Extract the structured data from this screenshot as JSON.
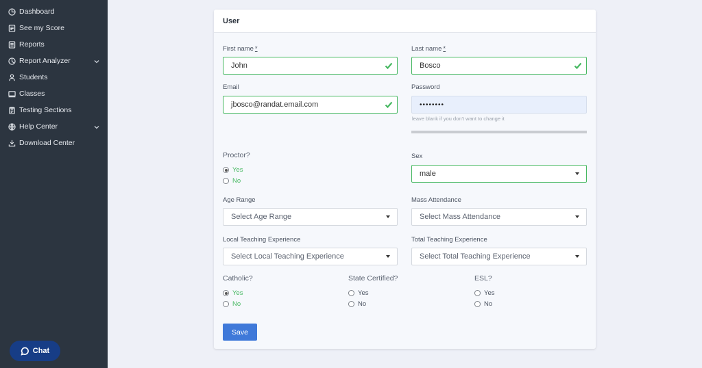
{
  "sidebar": {
    "items": [
      {
        "label": "Dashboard",
        "icon": "dashboard-icon"
      },
      {
        "label": "See my Score",
        "icon": "score-icon"
      },
      {
        "label": "Reports",
        "icon": "reports-icon"
      },
      {
        "label": "Report Analyzer",
        "icon": "analyzer-icon",
        "expandable": true
      },
      {
        "label": "Students",
        "icon": "students-icon"
      },
      {
        "label": "Classes",
        "icon": "classes-icon"
      },
      {
        "label": "Testing Sections",
        "icon": "clipboard-icon"
      },
      {
        "label": "Help Center",
        "icon": "help-icon",
        "expandable": true
      },
      {
        "label": "Download Center",
        "icon": "download-icon"
      }
    ]
  },
  "chat": {
    "label": "Chat"
  },
  "form": {
    "title": "User",
    "first_name": {
      "label": "First name",
      "required_mark": "*",
      "value": "John"
    },
    "last_name": {
      "label": "Last name",
      "required_mark": "*",
      "value": "Bosco"
    },
    "email": {
      "label": "Email",
      "value": "jbosco@randat.email.com"
    },
    "password": {
      "label": "Password",
      "value": "••••••••",
      "hint": "leave blank if you don't want to change it"
    },
    "proctor": {
      "label": "Proctor?",
      "options": [
        "Yes",
        "No"
      ],
      "selected": "Yes"
    },
    "sex": {
      "label": "Sex",
      "value": "male"
    },
    "age_range": {
      "label": "Age Range",
      "placeholder": "Select Age Range"
    },
    "mass_attendance": {
      "label": "Mass Attendance",
      "placeholder": "Select Mass Attendance"
    },
    "local_teaching": {
      "label": "Local Teaching Experience",
      "placeholder": "Select Local Teaching Experience"
    },
    "total_teaching": {
      "label": "Total Teaching Experience",
      "placeholder": "Select Total Teaching Experience"
    },
    "catholic": {
      "label": "Catholic?",
      "options": [
        "Yes",
        "No"
      ],
      "selected": "Yes"
    },
    "state_certified": {
      "label": "State Certified?",
      "options": [
        "Yes",
        "No"
      ],
      "selected": null
    },
    "esl": {
      "label": "ESL?",
      "options": [
        "Yes",
        "No"
      ],
      "selected": null
    },
    "save_label": "Save"
  },
  "colors": {
    "sidebar_bg": "#2c3540",
    "accent": "#3f79d9",
    "valid": "#46b861",
    "chat_bg": "#173d86"
  }
}
